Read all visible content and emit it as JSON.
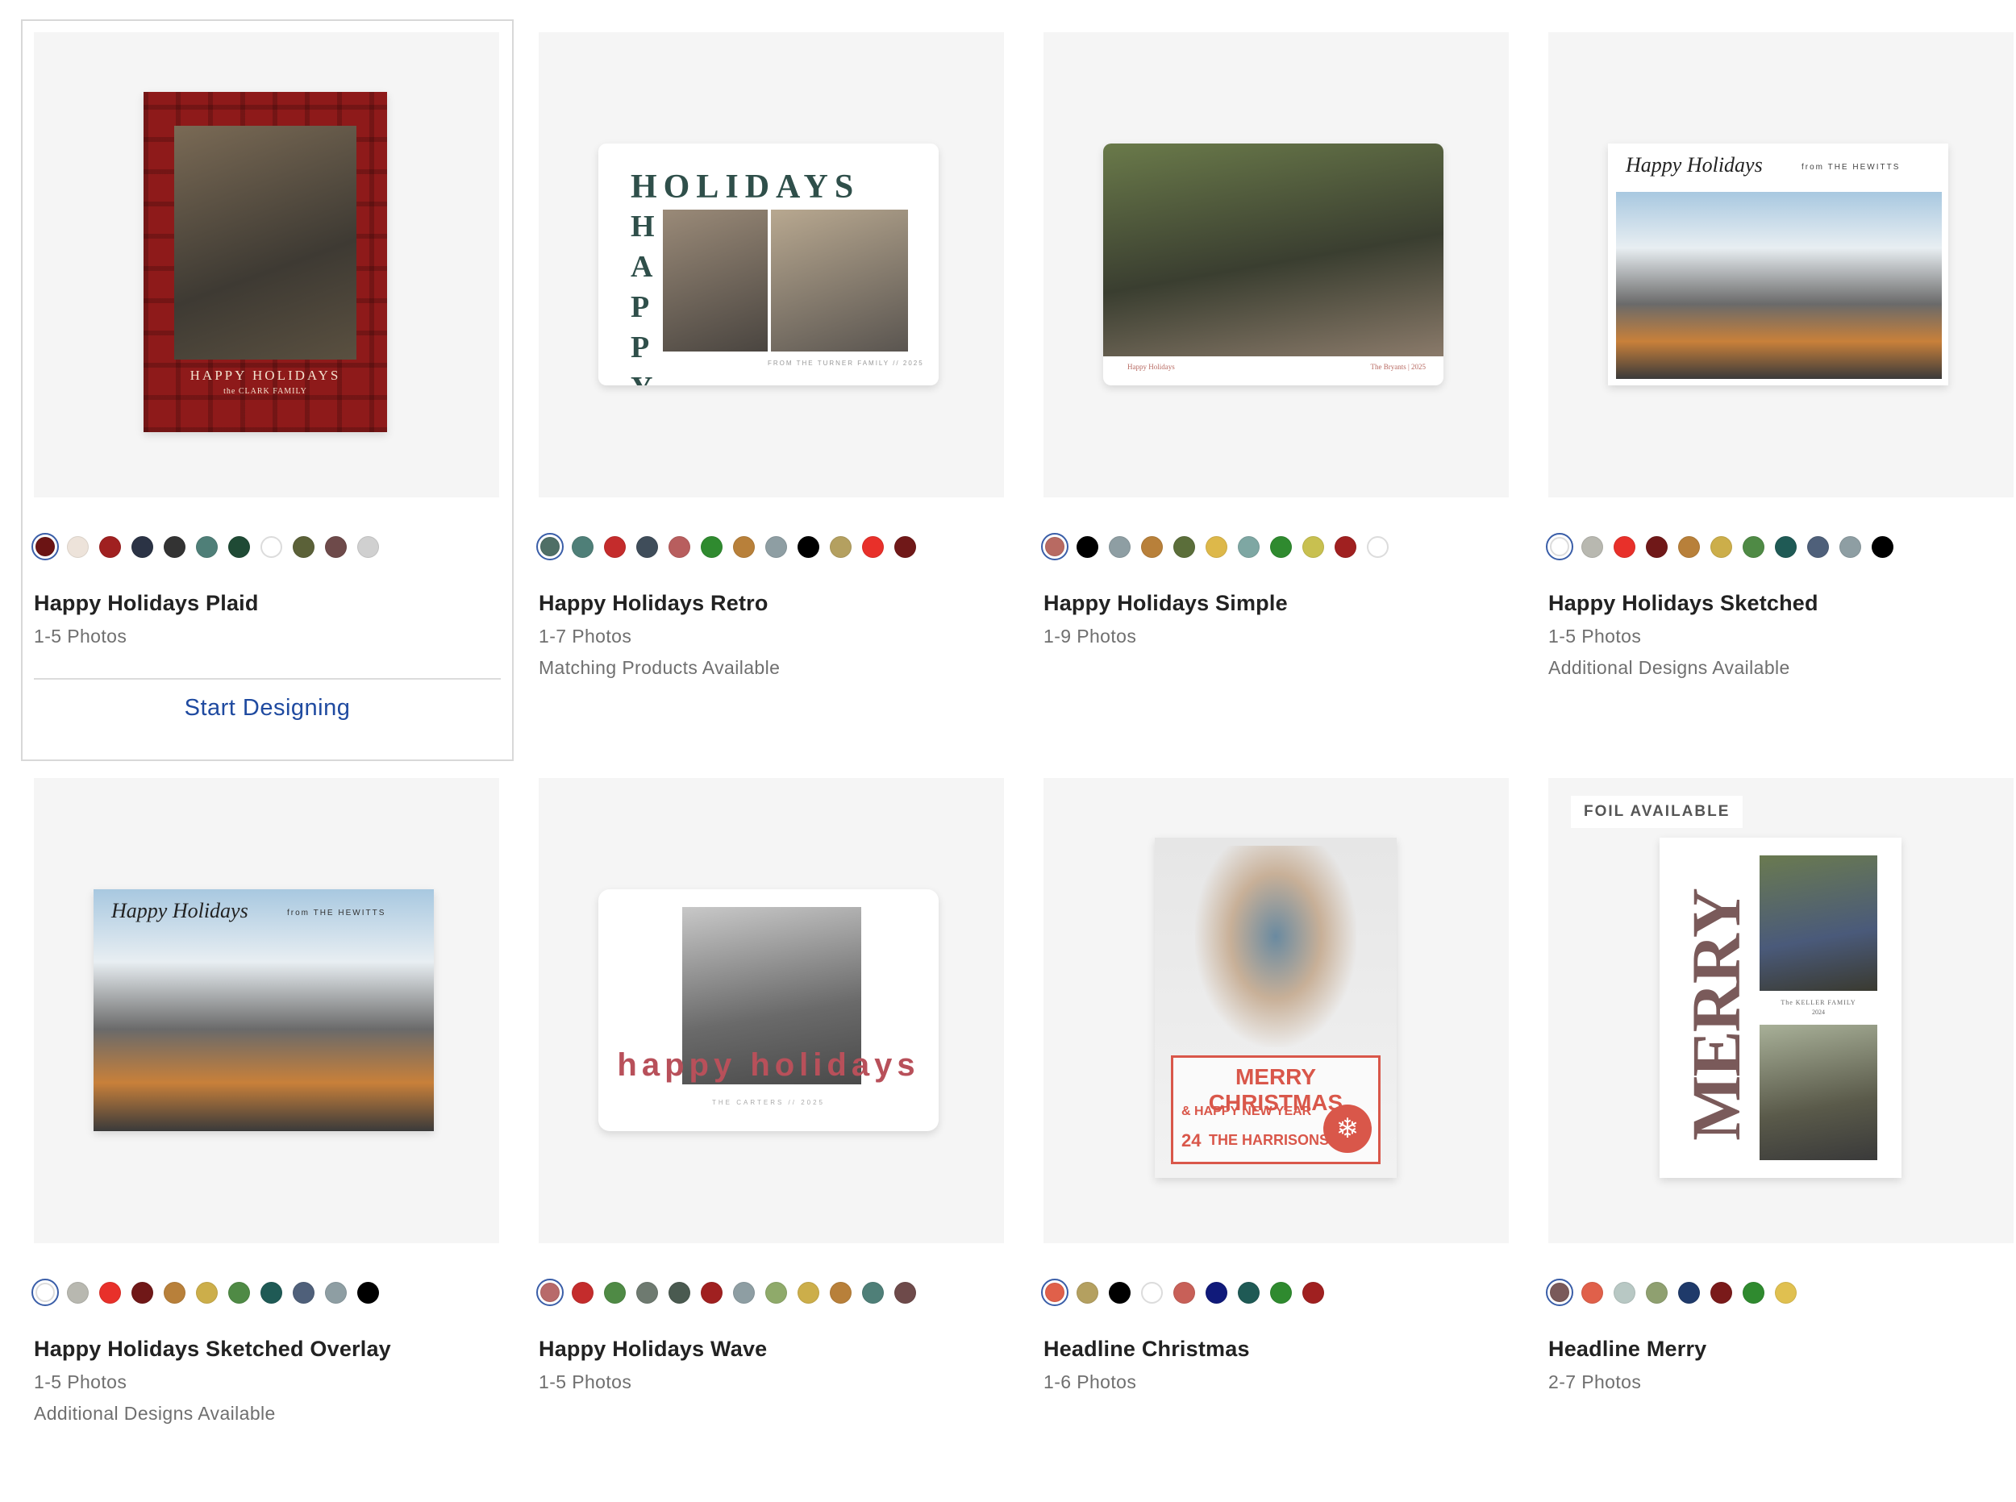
{
  "cards": [
    {
      "title": "Happy Holidays Plaid",
      "photos": "1-5 Photos",
      "cta": "Start Designing",
      "art_text": {
        "headline": "HAPPY HOLIDAYS",
        "sub": "the CLARK FAMILY"
      },
      "swatches": [
        "#6b1414",
        "#ede3da",
        "#a02020",
        "#2b3345",
        "#333333",
        "#4f7f78",
        "#1f4a35",
        "#ffffff",
        "#5b6138",
        "#6e4a4a",
        "#d0d0d0"
      ]
    },
    {
      "title": "Happy Holidays Retro",
      "photos": "1-7 Photos",
      "extra": "Matching Products Available",
      "art_text": {
        "word1": "HOLIDAYS",
        "word2": "HAPPY",
        "footer": "FROM THE TURNER FAMILY // 2025"
      },
      "swatches": [
        "#4f6f66",
        "#4f7f78",
        "#c42c2c",
        "#3f4d5a",
        "#b85e5e",
        "#2f8a2f",
        "#b8803a",
        "#8e9ea3",
        "#000000",
        "#b4a060",
        "#e8302a",
        "#701818"
      ]
    },
    {
      "title": "Happy Holidays Simple",
      "photos": "1-9 Photos",
      "art_text": {
        "left": "Happy Holidays",
        "right": "The Bryants | 2025"
      },
      "swatches": [
        "#b86a62",
        "#000000",
        "#8e9ea3",
        "#b8803a",
        "#5b6e3a",
        "#ddb84a",
        "#7ea7a3",
        "#2f8a2f",
        "#c8c050",
        "#a02020",
        "#ffffff"
      ]
    },
    {
      "title": "Happy Holidays Sketched",
      "photos": "1-5 Photos",
      "extra": "Additional Designs Available",
      "art_text": {
        "script": "Happy Holidays",
        "from": "from THE HEWITTS"
      },
      "swatches": [
        "#ffffff",
        "#b8b8b0",
        "#e8302a",
        "#701818",
        "#b8803a",
        "#ccae4a",
        "#4f8a45",
        "#1f5a55",
        "#4f607a",
        "#8e9ea3",
        "#000000"
      ]
    },
    {
      "title": "Happy Holidays Sketched Overlay",
      "photos": "1-5 Photos",
      "extra": "Additional Designs Available",
      "art_text": {
        "script": "Happy Holidays",
        "from": "from THE HEWITTS"
      },
      "swatches": [
        "#ffffff",
        "#b8b8b0",
        "#e8302a",
        "#701818",
        "#b8803a",
        "#ccae4a",
        "#4f8a45",
        "#1f5a55",
        "#4f607a",
        "#8e9ea3",
        "#000000"
      ]
    },
    {
      "title": "Happy Holidays Wave",
      "photos": "1-5 Photos",
      "art_text": {
        "arc": "happy holidays",
        "footer": "THE CARTERS // 2025"
      },
      "swatches": [
        "#b86a6a",
        "#c42c2c",
        "#4f8a45",
        "#6e7a70",
        "#4a5a50",
        "#a02020",
        "#8e9ea3",
        "#8faa6a",
        "#ccae4a",
        "#b8803a",
        "#4f7f78",
        "#6e4a4a"
      ]
    },
    {
      "title": "Headline Christmas",
      "photos": "1-6 Photos",
      "art_text": {
        "l1": "MERRY CHRISTMAS",
        "l2": "& HAPPY NEW YEAR",
        "num": "24",
        "l3": "THE HARRISONS"
      },
      "swatches": [
        "#e0604a",
        "#b4a060",
        "#000000",
        "#ffffff",
        "#c86058",
        "#101a7a",
        "#1f5a55",
        "#2f8a2f",
        "#a02020"
      ]
    },
    {
      "title": "Headline Merry",
      "photos": "2-7 Photos",
      "badge": "FOIL AVAILABLE",
      "art_text": {
        "word": "MERRY",
        "family": "The KELLER FAMILY",
        "year": "2024"
      },
      "swatches": [
        "#7a5a5a",
        "#e0604a",
        "#b8c8c4",
        "#8fa070",
        "#1f3a6a",
        "#7a1a1a",
        "#2f8a2f",
        "#e0c050"
      ]
    }
  ]
}
